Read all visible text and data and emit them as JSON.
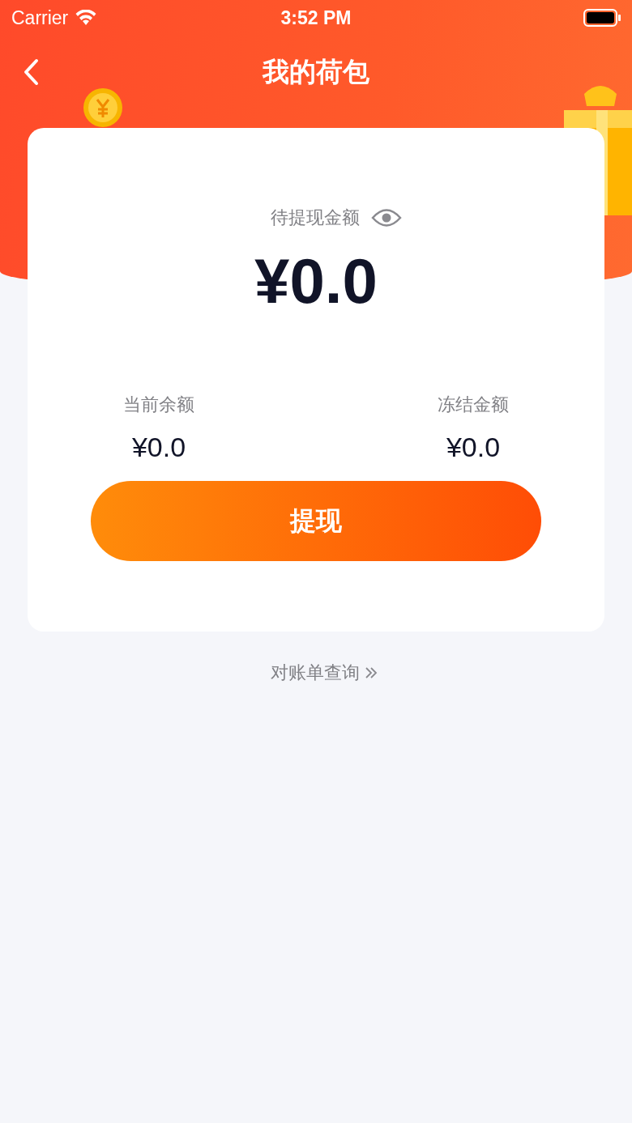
{
  "status_bar": {
    "carrier": "Carrier",
    "time": "3:52 PM"
  },
  "nav": {
    "title": "我的荷包"
  },
  "balance": {
    "label": "待提现金额",
    "amount": "¥0.0"
  },
  "sub_balances": [
    {
      "label": "当前余额",
      "amount": "¥0.0"
    },
    {
      "label": "冻结金额",
      "amount": "¥0.0"
    }
  ],
  "button": {
    "label": "提现"
  },
  "link": {
    "label": "对账单查询"
  }
}
